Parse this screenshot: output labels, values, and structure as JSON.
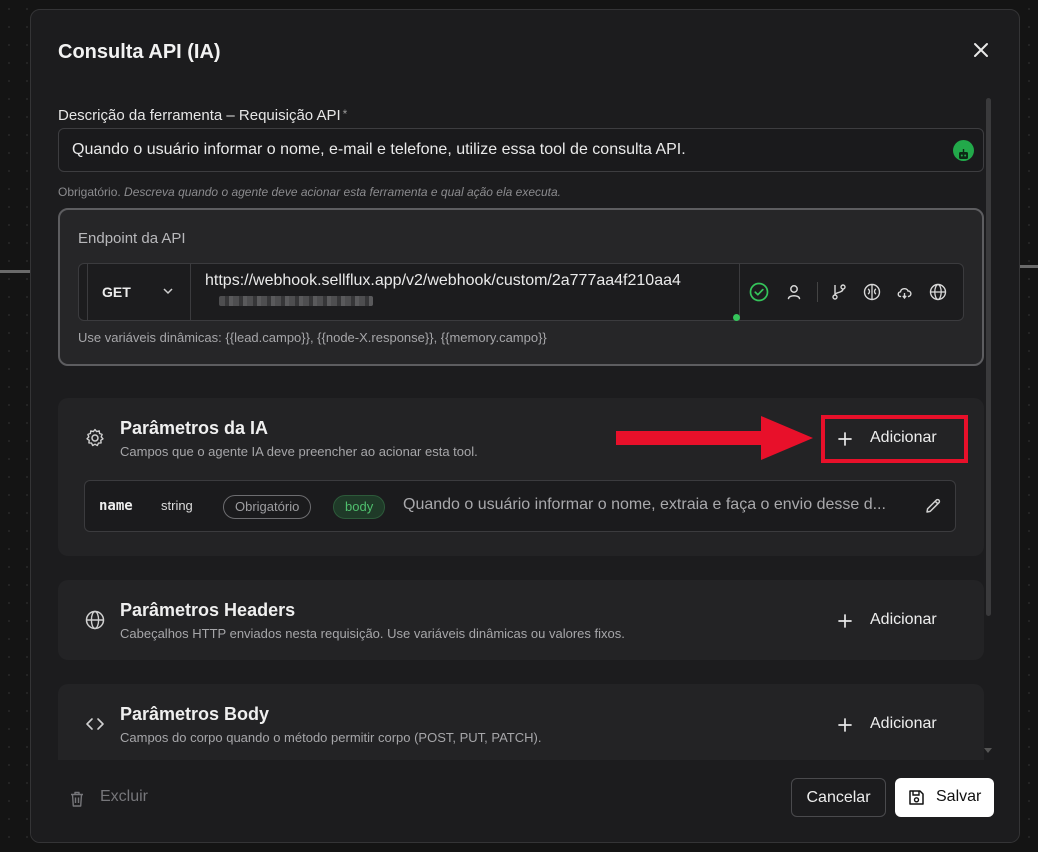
{
  "modal": {
    "title": "Consulta API (IA)"
  },
  "description_field": {
    "label": "Descrição da ferramenta – Requisição API",
    "required_mark": "*",
    "value": "Quando o usuário informar o nome, e-mail e telefone, utilize essa tool de consulta API.",
    "hint_required": "Obrigatório.",
    "hint_text": "Descreva quando o agente deve acionar esta ferramenta e qual ação ela executa."
  },
  "endpoint": {
    "title": "Endpoint da API",
    "method": "GET",
    "url": "https://webhook.sellflux.app/v2/webhook/custom/2a777aa4f210aa4",
    "hint": "Use variáveis dinâmicas: {{lead.campo}}, {{node-X.response}}, {{memory.campo}}",
    "tool_icons": [
      "check-circle-icon",
      "user-icon",
      "git-branch-icon",
      "brain-icon",
      "cloud-icon",
      "globe-icon"
    ]
  },
  "sections": {
    "ia": {
      "title": "Parâmetros da IA",
      "subtitle": "Campos que o agente IA deve preencher ao acionar esta tool.",
      "add_label": "Adicionar",
      "params": [
        {
          "name": "name",
          "type": "string",
          "required": "Obrigatório",
          "location": "body",
          "description": "Quando o usuário informar o nome, extraia e faça o envio desse d..."
        }
      ]
    },
    "headers": {
      "title": "Parâmetros Headers",
      "subtitle": "Cabeçalhos HTTP enviados nesta requisição. Use variáveis dinâmicas ou valores fixos.",
      "add_label": "Adicionar"
    },
    "body": {
      "title": "Parâmetros Body",
      "subtitle": "Campos do corpo quando o método permitir corpo (POST, PUT, PATCH).",
      "add_label": "Adicionar"
    }
  },
  "footer": {
    "delete_label": "Excluir",
    "cancel_label": "Cancelar",
    "save_label": "Salvar"
  },
  "colors": {
    "highlight": "#e8102a",
    "accent_green": "#35c45b",
    "surface": "#1c1c1e"
  }
}
